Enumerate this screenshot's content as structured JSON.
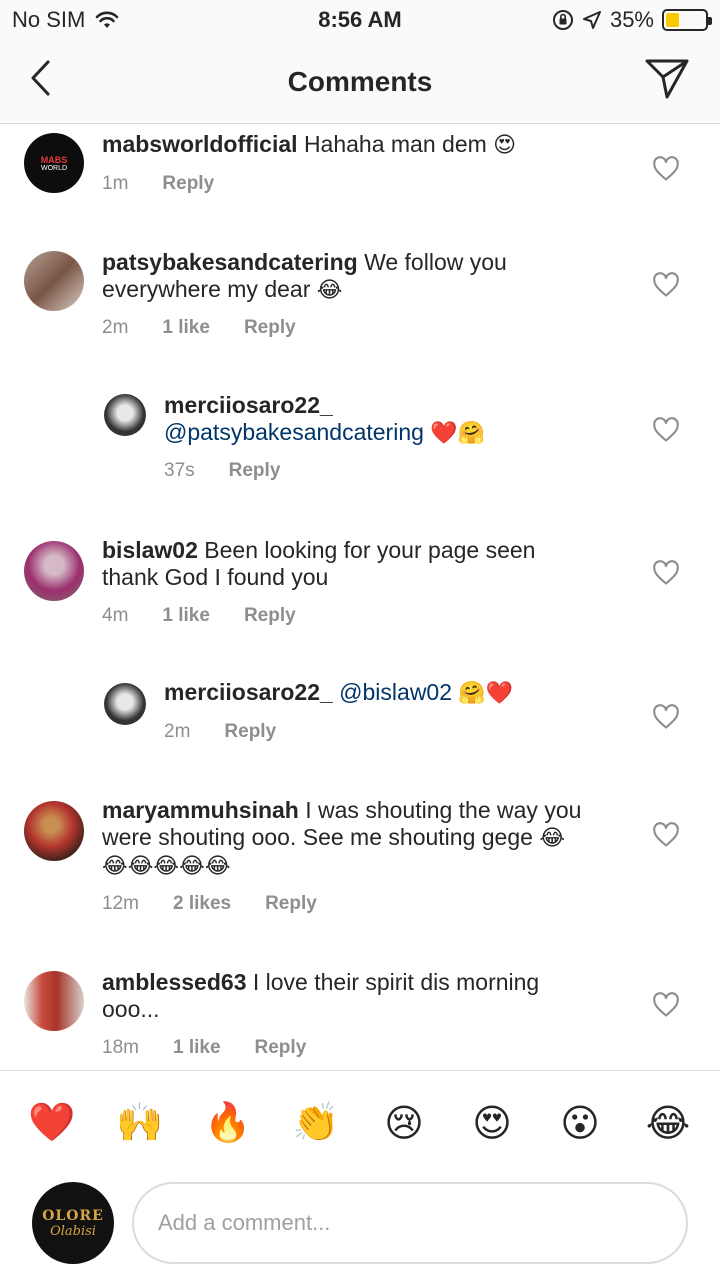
{
  "status_bar": {
    "carrier": "No SIM",
    "time": "8:56 AM",
    "battery": "35%",
    "battery_level": 0.35,
    "battery_color": "#f7c900"
  },
  "header": {
    "title": "Comments",
    "back_icon": "chevron-left-icon",
    "send_icon": "paper-plane-icon"
  },
  "comments": [
    {
      "username": "mabsworldofficial",
      "text": "Hahaha man dem",
      "emoji": "😍",
      "time": "1m",
      "likes": "",
      "reply": "Reply",
      "avatar_text": "MABS WORLD"
    },
    {
      "username": "patsybakesandcatering",
      "text": "We follow you everywhere my dear",
      "emoji": "😂",
      "time": "2m",
      "likes": "1 like",
      "reply": "Reply"
    },
    {
      "username": "merciiosaro22_",
      "mention": "@patsybakesandcatering",
      "emoji": "❤️🤗",
      "time": "37s",
      "likes": "",
      "reply": "Reply",
      "is_reply": true
    },
    {
      "username": "bislaw02",
      "text": "Been looking for your page seen thank God I found you",
      "time": "4m",
      "likes": "1 like",
      "reply": "Reply"
    },
    {
      "username": "merciiosaro22_",
      "mention": "@bislaw02",
      "emoji": "🤗❤️",
      "time": "2m",
      "likes": "",
      "reply": "Reply",
      "is_reply": true
    },
    {
      "username": "maryammuhsinah",
      "text": "I was shouting the way you were shouting ooo. See me shouting gege",
      "emoji": "😂",
      "emoji_line": "😂😂😂😂😂",
      "time": "12m",
      "likes": "2 likes",
      "reply": "Reply"
    },
    {
      "username": "amblessed63",
      "text": "I love their spirit dis morning ooo...",
      "time": "18m",
      "likes": "1 like",
      "reply": "Reply"
    }
  ],
  "reactions": [
    "❤️",
    "🙌",
    "🔥",
    "👏",
    "😢",
    "😍",
    "😮",
    "😂"
  ],
  "composer": {
    "placeholder": "Add a comment...",
    "avatar_line1": "OLORE",
    "avatar_line2": "Olabisi"
  }
}
